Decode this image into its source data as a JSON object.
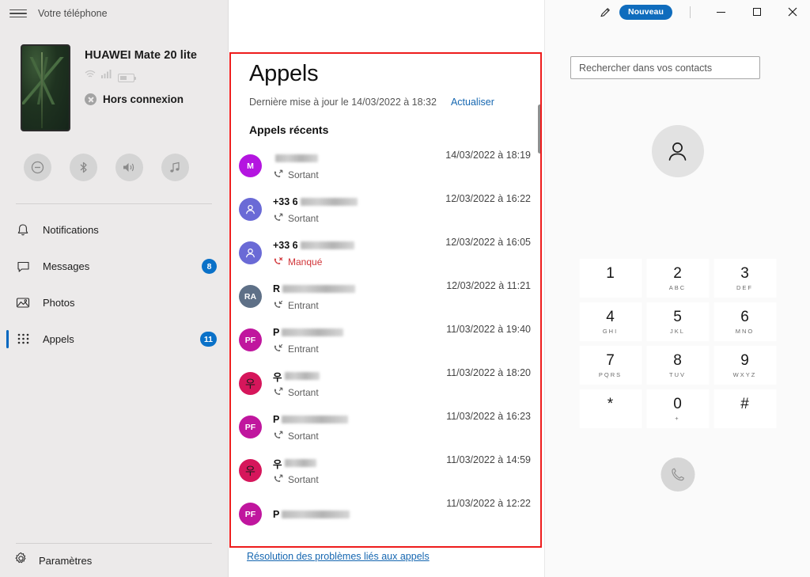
{
  "window": {
    "app_title": "Votre téléphone",
    "new_badge": "Nouveau",
    "minimize_label": "Réduire",
    "maximize_label": "Agrandir",
    "close_label": "Fermer"
  },
  "sidebar": {
    "device": {
      "name": "HUAWEI Mate 20 lite",
      "connection_status": "Hors connexion"
    },
    "quick_actions": [
      {
        "name": "do-not-disturb",
        "label": "Ne pas déranger"
      },
      {
        "name": "bluetooth",
        "label": "Bluetooth"
      },
      {
        "name": "volume",
        "label": "Volume"
      },
      {
        "name": "music",
        "label": "Musique"
      }
    ],
    "items": [
      {
        "label": "Notifications",
        "badge": "",
        "active": false
      },
      {
        "label": "Messages",
        "badge": "8",
        "active": false
      },
      {
        "label": "Photos",
        "badge": "",
        "active": false
      },
      {
        "label": "Appels",
        "badge": "11",
        "active": true
      }
    ],
    "settings_label": "Paramètres"
  },
  "calls": {
    "title": "Appels",
    "last_update": "Dernière mise à jour le 14/03/2022 à 18:32",
    "refresh_label": "Actualiser",
    "section_label": "Appels récents",
    "trouble_link": "Résolution des problèmes liés aux appels",
    "type_outgoing": "Sortant",
    "type_incoming": "Entrant",
    "type_missed": "Manqué",
    "rows": [
      {
        "initials": "M",
        "avatar_color": "#b415e0",
        "glyph": false,
        "name_prefix": "",
        "redact_width": 54,
        "type": "Sortant",
        "missed": false,
        "time": "14/03/2022 à 18:19"
      },
      {
        "initials": "",
        "avatar_color": "#6a6ad6",
        "glyph": false,
        "name_prefix": "+33 6",
        "redact_width": 72,
        "type": "Sortant",
        "missed": false,
        "time": "12/03/2022 à 16:22"
      },
      {
        "initials": "",
        "avatar_color": "#6a6ad6",
        "glyph": false,
        "name_prefix": "+33 6",
        "redact_width": 68,
        "type": "Manqué",
        "missed": true,
        "time": "12/03/2022 à 16:05"
      },
      {
        "initials": "RA",
        "avatar_color": "#5e7087",
        "glyph": false,
        "name_prefix": "R",
        "redact_width": 92,
        "type": "Entrant",
        "missed": false,
        "time": "12/03/2022 à 11:21"
      },
      {
        "initials": "PF",
        "avatar_color": "#c0169e",
        "glyph": false,
        "name_prefix": "P",
        "redact_width": 78,
        "type": "Entrant",
        "missed": false,
        "time": "11/03/2022 à 19:40"
      },
      {
        "initials": "우",
        "avatar_color": "#d6165b",
        "glyph": true,
        "name_prefix": "우",
        "redact_width": 44,
        "type": "Sortant",
        "missed": false,
        "time": "11/03/2022 à 18:20"
      },
      {
        "initials": "PF",
        "avatar_color": "#c0169e",
        "glyph": false,
        "name_prefix": "P",
        "redact_width": 84,
        "type": "Sortant",
        "missed": false,
        "time": "11/03/2022 à 16:23"
      },
      {
        "initials": "우",
        "avatar_color": "#d6165b",
        "glyph": true,
        "name_prefix": "우",
        "redact_width": 40,
        "type": "Sortant",
        "missed": false,
        "time": "11/03/2022 à 14:59"
      },
      {
        "initials": "PF",
        "avatar_color": "#c0169e",
        "glyph": false,
        "name_prefix": "P",
        "redact_width": 86,
        "type": "",
        "missed": false,
        "time": "11/03/2022 à 12:22"
      }
    ]
  },
  "dialer": {
    "search_placeholder": "Rechercher dans vos contacts",
    "search_value": "",
    "keys": [
      {
        "digit": "1",
        "letters": ""
      },
      {
        "digit": "2",
        "letters": "ABC"
      },
      {
        "digit": "3",
        "letters": "DEF"
      },
      {
        "digit": "4",
        "letters": "GHI"
      },
      {
        "digit": "5",
        "letters": "JKL"
      },
      {
        "digit": "6",
        "letters": "MNO"
      },
      {
        "digit": "7",
        "letters": "PQRS"
      },
      {
        "digit": "8",
        "letters": "TUV"
      },
      {
        "digit": "9",
        "letters": "WXYZ"
      },
      {
        "digit": "*",
        "letters": ""
      },
      {
        "digit": "0",
        "letters": "+"
      },
      {
        "digit": "#",
        "letters": ""
      }
    ],
    "call_button_label": "Appeler"
  },
  "colors": {
    "accent": "#0f6cbd",
    "link": "#1667b1",
    "missed": "#d13438",
    "highlight_outline": "#ee1c1c",
    "sidebar_bg": "#eceaea"
  }
}
